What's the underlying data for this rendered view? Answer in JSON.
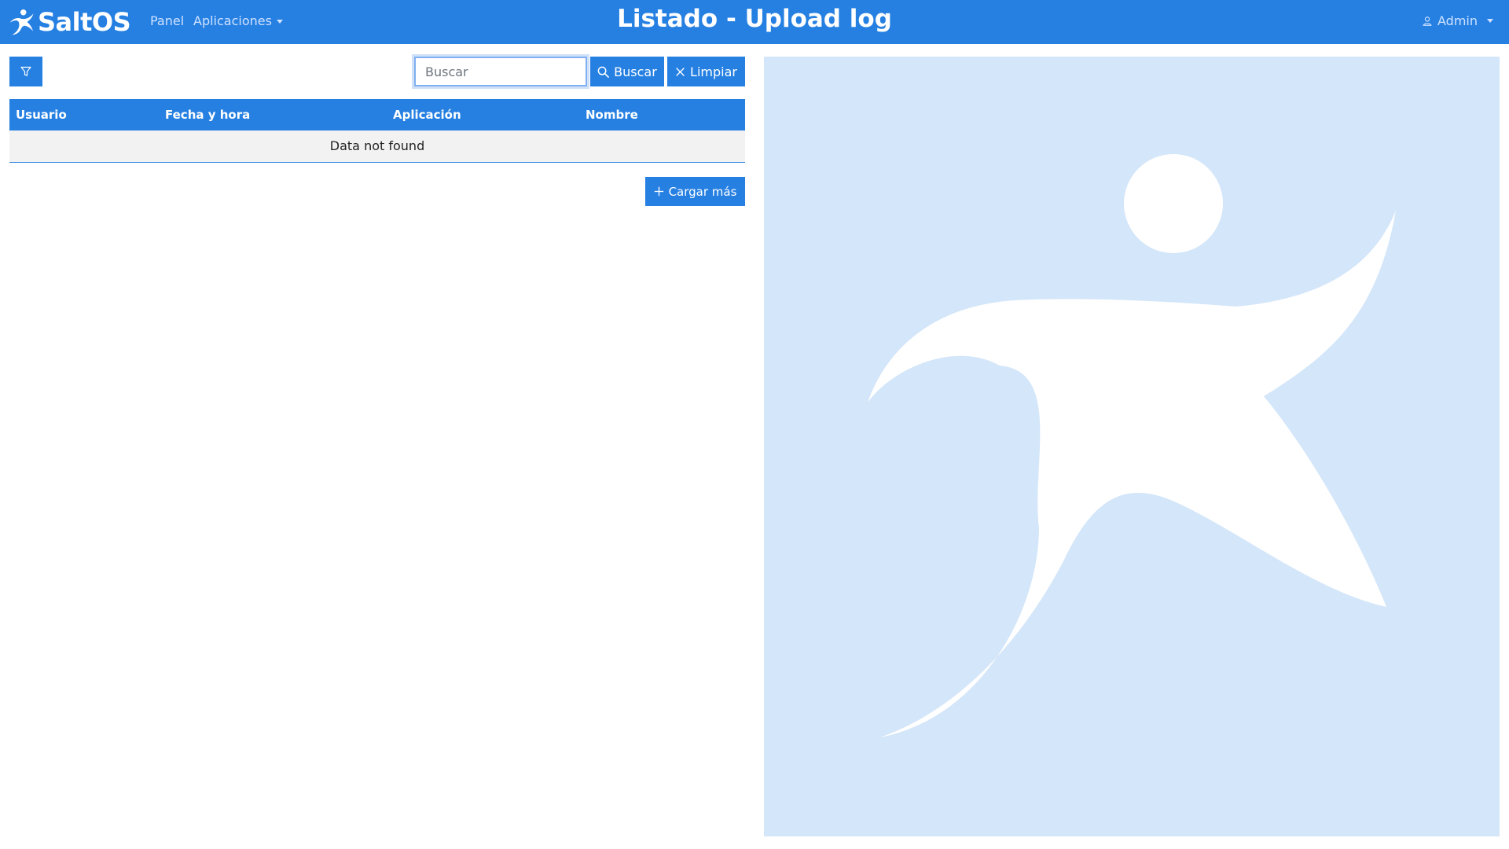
{
  "navbar": {
    "brand": "SaltOS",
    "links": [
      {
        "label": "Panel"
      },
      {
        "label": "Aplicaciones"
      }
    ],
    "title": "Listado - Upload log",
    "user": "Admin"
  },
  "toolbar": {
    "filter_icon": "filter-icon",
    "search_placeholder": "Buscar",
    "search_value": "",
    "buscar_label": "Buscar",
    "limpiar_label": "Limpiar"
  },
  "table": {
    "columns": [
      "Usuario",
      "Fecha y hora",
      "Aplicación",
      "Nombre"
    ],
    "empty_message": "Data not found"
  },
  "load_more_label": "Cargar más",
  "colors": {
    "primary": "#2680e2",
    "panel_bg": "#d4e6f9"
  }
}
